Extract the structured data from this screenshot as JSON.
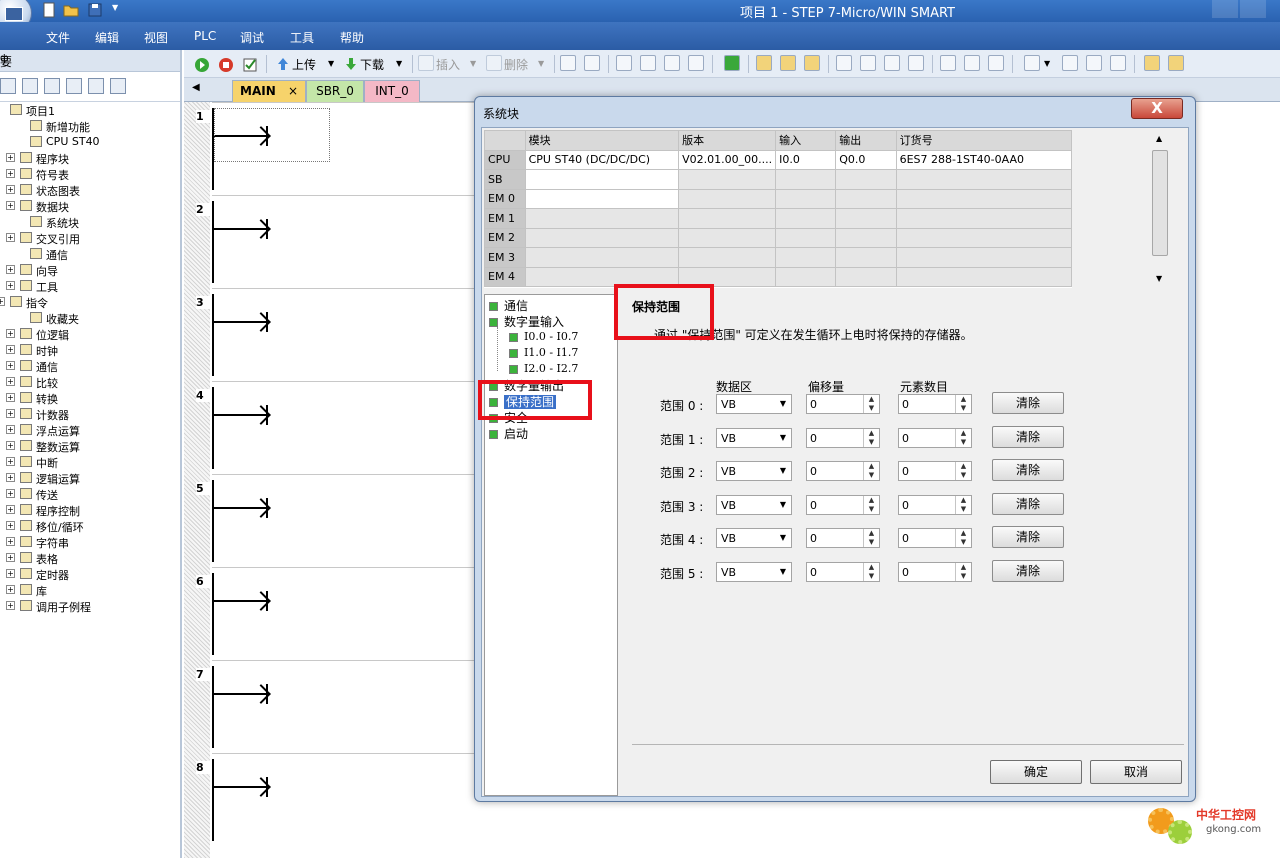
{
  "window": {
    "title": "项目 1 - STEP 7-Micro/WIN SMART"
  },
  "menu": [
    "文件",
    "编辑",
    "视图",
    "PLC",
    "调试",
    "工具",
    "帮助"
  ],
  "left_panel": {
    "header": "要",
    "pin": "ф",
    "tree": [
      {
        "label": "项目1",
        "indent": 0,
        "expander": false
      },
      {
        "label": "新增功能",
        "indent": 2,
        "expander": false
      },
      {
        "label": "CPU ST40",
        "indent": 2,
        "expander": false
      },
      {
        "label": "程序块",
        "indent": 1,
        "expander": true
      },
      {
        "label": "符号表",
        "indent": 1,
        "expander": true
      },
      {
        "label": "状态图表",
        "indent": 1,
        "expander": true
      },
      {
        "label": "数据块",
        "indent": 1,
        "expander": true
      },
      {
        "label": "系统块",
        "indent": 2,
        "expander": false
      },
      {
        "label": "交叉引用",
        "indent": 1,
        "expander": true
      },
      {
        "label": "通信",
        "indent": 2,
        "expander": false
      },
      {
        "label": "向导",
        "indent": 1,
        "expander": true
      },
      {
        "label": "工具",
        "indent": 1,
        "expander": true
      },
      {
        "label": "指令",
        "indent": 0,
        "expander": true
      },
      {
        "label": "收藏夹",
        "indent": 2,
        "expander": false
      },
      {
        "label": "位逻辑",
        "indent": 1,
        "expander": true
      },
      {
        "label": "时钟",
        "indent": 1,
        "expander": true
      },
      {
        "label": "通信",
        "indent": 1,
        "expander": true
      },
      {
        "label": "比较",
        "indent": 1,
        "expander": true
      },
      {
        "label": "转换",
        "indent": 1,
        "expander": true
      },
      {
        "label": "计数器",
        "indent": 1,
        "expander": true
      },
      {
        "label": "浮点运算",
        "indent": 1,
        "expander": true
      },
      {
        "label": "整数运算",
        "indent": 1,
        "expander": true
      },
      {
        "label": "中断",
        "indent": 1,
        "expander": true
      },
      {
        "label": "逻辑运算",
        "indent": 1,
        "expander": true
      },
      {
        "label": "传送",
        "indent": 1,
        "expander": true
      },
      {
        "label": "程序控制",
        "indent": 1,
        "expander": true
      },
      {
        "label": "移位/循环",
        "indent": 1,
        "expander": true
      },
      {
        "label": "字符串",
        "indent": 1,
        "expander": true
      },
      {
        "label": "表格",
        "indent": 1,
        "expander": true
      },
      {
        "label": "定时器",
        "indent": 1,
        "expander": true
      },
      {
        "label": "库",
        "indent": 1,
        "expander": true
      },
      {
        "label": "调用子例程",
        "indent": 1,
        "expander": true
      }
    ]
  },
  "toolbar": {
    "upload": "上传",
    "download": "下载",
    "insert": "插入",
    "delete": "删除"
  },
  "tabs": [
    {
      "label": "MAIN",
      "close": "×",
      "color": "#f6d36b"
    },
    {
      "label": "SBR_0",
      "color": "#c4e6a8"
    },
    {
      "label": "INT_0",
      "color": "#f4b8c6"
    }
  ],
  "networks": [
    "1",
    "2",
    "3",
    "4",
    "5",
    "6",
    "7",
    "8"
  ],
  "dialog": {
    "title": "系统块",
    "close": "X",
    "module_table": {
      "headers": [
        "",
        "模块",
        "版本",
        "输入",
        "输出",
        "订货号"
      ],
      "rows": [
        [
          "CPU",
          "CPU ST40 (DC/DC/DC)",
          "V02.01.00_00....",
          "I0.0",
          "Q0.0",
          "6ES7 288-1ST40-0AA0"
        ],
        [
          "SB",
          "",
          "",
          "",
          "",
          ""
        ],
        [
          "EM 0",
          "",
          "",
          "",
          "",
          ""
        ],
        [
          "EM 1",
          "",
          "",
          "",
          "",
          ""
        ],
        [
          "EM 2",
          "",
          "",
          "",
          "",
          ""
        ],
        [
          "EM 3",
          "",
          "",
          "",
          "",
          ""
        ],
        [
          "EM 4",
          "",
          "",
          "",
          "",
          ""
        ]
      ]
    },
    "nav": {
      "comm": "通信",
      "digital_in": "数字量输入",
      "sub1": "I0.0 - I0.7",
      "sub2": "I1.0 - I1.7",
      "sub3": "I2.0 - I2.7",
      "digital_out": "数字量输出",
      "retain": "保持范围",
      "security": "安全",
      "startup": "启动"
    },
    "content": {
      "title": "保持范围",
      "description": "通过 \"保持范围\" 可定义在发生循环上电时将保持的存储器。",
      "col_area": "数据区",
      "col_offset": "偏移量",
      "col_count": "元素数目",
      "ranges": [
        {
          "label": "范围 0 :",
          "area": "VB",
          "offset": "0",
          "count": "0",
          "clear": "清除"
        },
        {
          "label": "范围 1 :",
          "area": "VB",
          "offset": "0",
          "count": "0",
          "clear": "清除"
        },
        {
          "label": "范围 2 :",
          "area": "VB",
          "offset": "0",
          "count": "0",
          "clear": "清除"
        },
        {
          "label": "范围 3 :",
          "area": "VB",
          "offset": "0",
          "count": "0",
          "clear": "清除"
        },
        {
          "label": "范围 4 :",
          "area": "VB",
          "offset": "0",
          "count": "0",
          "clear": "清除"
        },
        {
          "label": "范围 5 :",
          "area": "VB",
          "offset": "0",
          "count": "0",
          "clear": "清除"
        }
      ]
    },
    "ok": "确定",
    "cancel": "取消"
  },
  "watermark": {
    "cn": "中华工控网",
    "en": "gkong.com"
  },
  "colors": {
    "highlight": "#e8101a",
    "selection": "#3a70c8"
  }
}
